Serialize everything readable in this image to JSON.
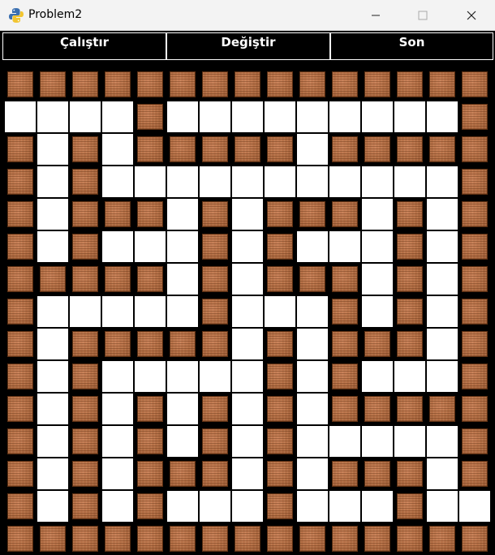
{
  "window": {
    "title": "Problem2",
    "icon": "python-icon"
  },
  "menu": {
    "buttons": [
      {
        "label": "Çalıştır",
        "name": "run-button"
      },
      {
        "label": "Değiştir",
        "name": "change-button"
      },
      {
        "label": "Son",
        "name": "end-button"
      }
    ]
  },
  "maze": {
    "colors": {
      "wall": "#000000",
      "open": "#ffffff",
      "brick": "#b36e45"
    },
    "legend": {
      "X": "brick-wall",
      ".": "open-path"
    },
    "rows": [
      "XXXXXXXXXXXXXXX",
      "....X.........X",
      "X.X.XXXXX.XXXXX",
      "X.X...........X",
      "X.XXX.X.XXX.X.X",
      "X.X...X.X...X.X",
      "XXXXX.X.XXX.X.X",
      "X.....X...X.X.X",
      "X.XXXXX.X.XXX.X",
      "X.X.....X.X...X",
      "X.X.X.X.X.XXXXX",
      "X.X.X.X.X.....X",
      "X.X.XXX.X.XXX.X",
      "X.X.X...X...X..",
      "XXXXXXXXXXXXXXX"
    ]
  }
}
